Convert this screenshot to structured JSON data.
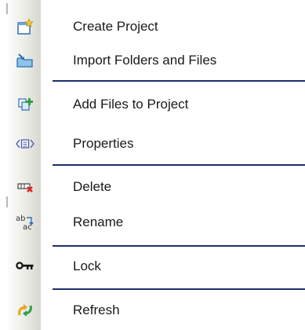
{
  "menu": {
    "items": [
      {
        "label": "Create Project",
        "icon": "create-project-icon"
      },
      {
        "label": "Import Folders and Files",
        "icon": "import-folder-icon"
      },
      {
        "label": "Add Files to Project",
        "icon": "add-files-icon"
      },
      {
        "label": "Properties",
        "icon": "properties-icon"
      },
      {
        "label": "Delete",
        "icon": "delete-icon"
      },
      {
        "label": "Rename",
        "icon": "rename-icon"
      },
      {
        "label": "Lock",
        "icon": "lock-key-icon"
      },
      {
        "label": "Refresh",
        "icon": "refresh-icon"
      }
    ]
  },
  "colors": {
    "separator": "#1c2f6b",
    "text": "#1a1a1a",
    "gutter": "#e6e6e0"
  }
}
